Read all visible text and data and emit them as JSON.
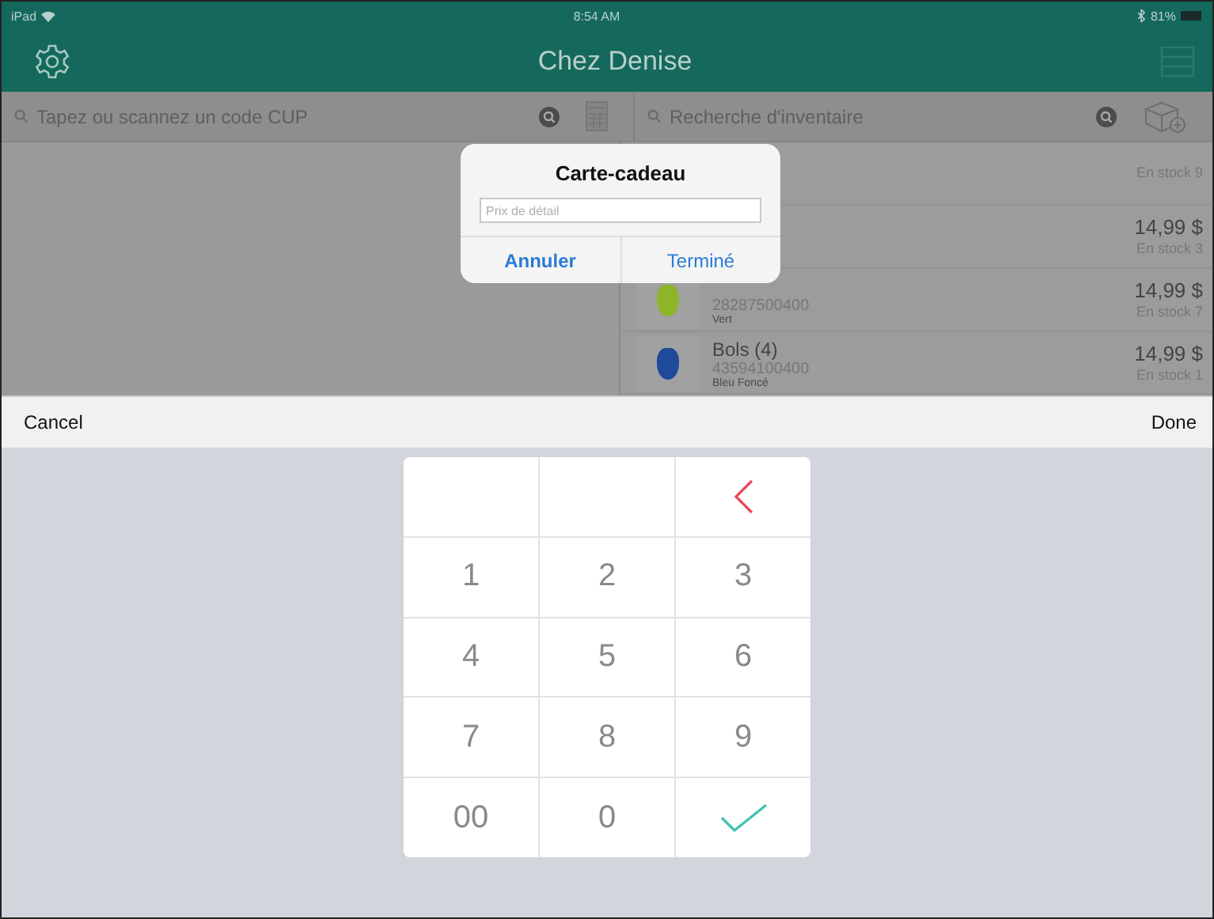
{
  "status_bar": {
    "device": "iPad",
    "time": "8:54 AM",
    "battery": "81%"
  },
  "header": {
    "title": "Chez Denise"
  },
  "left_search": {
    "placeholder": "Tapez ou scannez un code CUP"
  },
  "right_search": {
    "placeholder": "Recherche d'inventaire"
  },
  "inventory": [
    {
      "stock": "En stock 9"
    },
    {
      "price": "14,99 $",
      "stock": "En stock 3"
    },
    {
      "code": "28287500400",
      "variant": "Vert",
      "price": "14,99 $",
      "stock": "En stock 7",
      "color": "#8db52a"
    },
    {
      "name": "Bols (4)",
      "code": "43594100400",
      "variant": "Bleu Foncé",
      "price": "14,99 $",
      "stock": "En stock 1",
      "color": "#1f4a9a"
    }
  ],
  "dialog": {
    "title": "Carte-cadeau",
    "placeholder": "Prix de détail",
    "buttons": [
      "Annuler",
      "Terminé"
    ]
  },
  "keyboard_toolbar": {
    "cancel": "Cancel",
    "done": "Done"
  },
  "keypad": [
    {
      "kind": "blank"
    },
    {
      "kind": "blank"
    },
    {
      "kind": "backspace"
    },
    {
      "kind": "digit",
      "label": "1"
    },
    {
      "kind": "digit",
      "label": "2"
    },
    {
      "kind": "digit",
      "label": "3"
    },
    {
      "kind": "digit",
      "label": "4"
    },
    {
      "kind": "digit",
      "label": "5"
    },
    {
      "kind": "digit",
      "label": "6"
    },
    {
      "kind": "digit",
      "label": "7"
    },
    {
      "kind": "digit",
      "label": "8"
    },
    {
      "kind": "digit",
      "label": "9"
    },
    {
      "kind": "digit",
      "label": "00"
    },
    {
      "kind": "digit",
      "label": "0"
    },
    {
      "kind": "confirm"
    }
  ]
}
